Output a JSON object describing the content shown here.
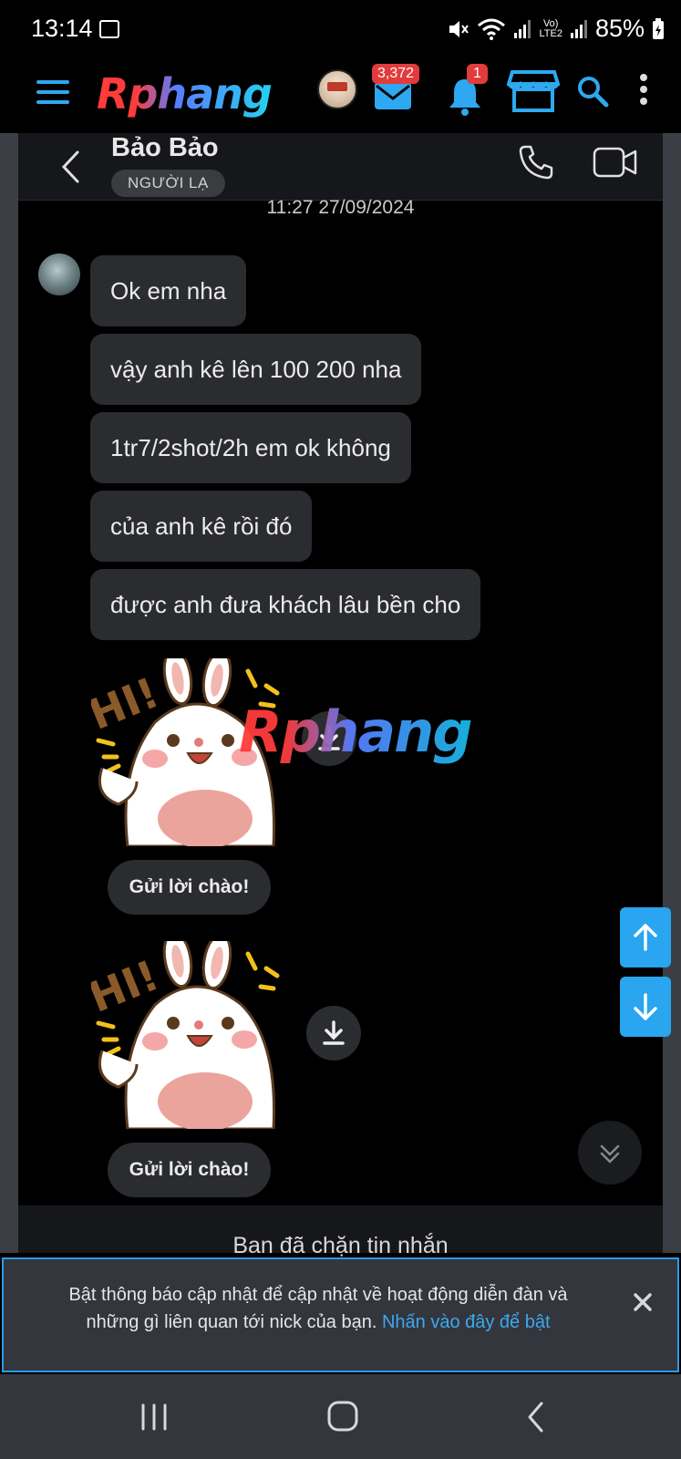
{
  "status_bar": {
    "time": "13:14",
    "battery": "85%",
    "network_label_top": "Vo)",
    "network_label_bottom": "LTE2"
  },
  "app_header": {
    "logo_text": "Rphang",
    "mail_badge": "3,372",
    "bell_badge": "1"
  },
  "chat": {
    "contact_name": "Bảo Bảo",
    "contact_tag": "NGƯỜI LẠ",
    "timestamp": "11:27 27/09/2024",
    "messages": [
      "Ok em nha",
      "vậy anh kê lên 100 200 nha",
      "1tr7/2shot/2h em ok không",
      "của anh kê rồi đó",
      "được anh đưa khách lâu bền cho"
    ],
    "sticker_caption": "HI!",
    "greeting_buttons": [
      "Gửi lời chào!",
      "Gửi lời chào!"
    ],
    "watermark_text": "Rphang",
    "blocked_text": "Ban đã chặn tin nhắn"
  },
  "notice": {
    "text": "Bật thông báo cập nhật để cập nhật về hoạt động diễn đàn và những gì liên quan tới nick của bạn.",
    "link": "Nhấn vào đây để bật"
  },
  "colors": {
    "accent": "#2aa5ef",
    "badge": "#e23b3b",
    "bubble": "#2b2c2f"
  }
}
